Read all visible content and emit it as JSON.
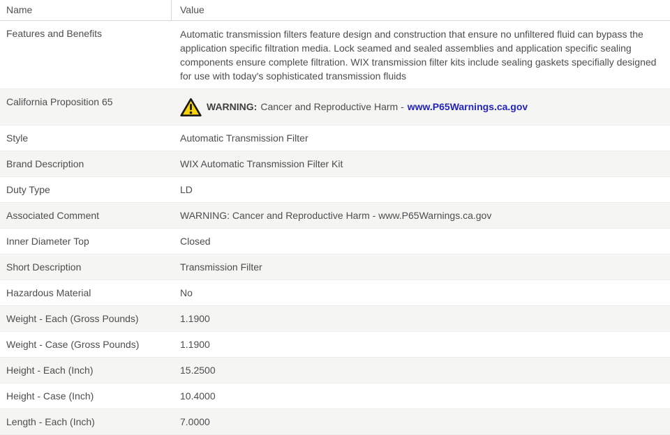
{
  "header": {
    "name_column_label": "Name",
    "value_column_label": "Value"
  },
  "rows": [
    {
      "name": "Features and Benefits",
      "value": "Automatic transmission filters feature design and construction that ensure no unfiltered fluid can bypass the application specific filtration media. Lock seamed and sealed assemblies and application specific sealing components ensure complete filtration. WIX transmission filter kits include sealing gaskets specifially designed for use with today's sophisticated transmission fluids"
    },
    {
      "name": "California Proposition 65",
      "warning_label": "WARNING:",
      "warning_text": "Cancer and Reproductive Harm -",
      "warning_link": "www.P65Warnings.ca.gov"
    },
    {
      "name": "Style",
      "value": "Automatic Transmission Filter"
    },
    {
      "name": "Brand Description",
      "value": "WIX Automatic Transmission Filter Kit"
    },
    {
      "name": "Duty Type",
      "value": "LD"
    },
    {
      "name": "Associated Comment",
      "value": "WARNING: Cancer and Reproductive Harm - www.P65Warnings.ca.gov"
    },
    {
      "name": "Inner Diameter Top",
      "value": "Closed"
    },
    {
      "name": "Short Description",
      "value": "Transmission Filter"
    },
    {
      "name": "Hazardous Material",
      "value": "No"
    },
    {
      "name": "Weight - Each (Gross Pounds)",
      "value": "1.1900"
    },
    {
      "name": "Weight - Case (Gross Pounds)",
      "value": "1.1900"
    },
    {
      "name": "Height - Each (Inch)",
      "value": "15.2500"
    },
    {
      "name": "Height - Case (Inch)",
      "value": "10.4000"
    },
    {
      "name": "Length - Each (Inch)",
      "value": "7.0000"
    }
  ],
  "icons": {
    "warning_triangle": "warning-triangle-icon"
  },
  "colors": {
    "row_alt_bg": "#f5f5f3",
    "header_border": "#d8d8d8",
    "row_border": "#efedea",
    "text": "#4d4d4d",
    "link_blue": "#2323bd",
    "warning_yellow": "#f8d308",
    "warning_outline": "#1a1a1a"
  }
}
